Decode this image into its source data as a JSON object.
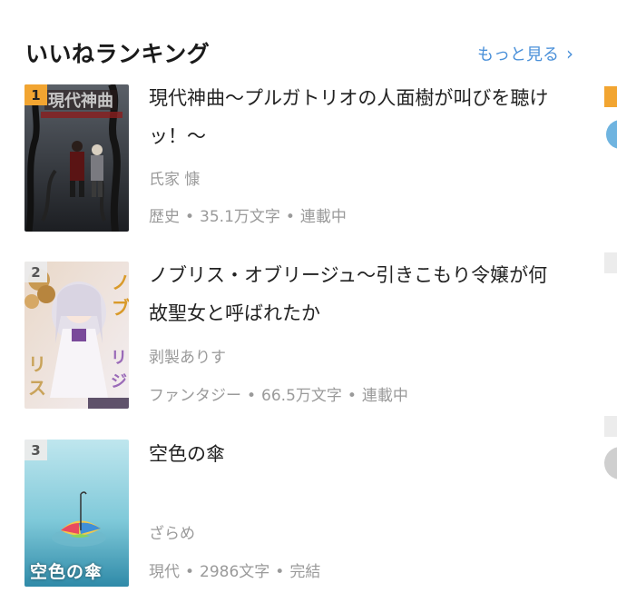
{
  "section": {
    "title": "いいねランキング",
    "more_label": "もっと見る"
  },
  "items": [
    {
      "rank": "1",
      "title": "現代神曲〜プルガトリオの人面樹が叫びを聴けッ！〜",
      "author": "氏家 慷",
      "genre": "歴史",
      "length": "35.1万文字",
      "status": "連載中"
    },
    {
      "rank": "2",
      "title": "ノブリス・オブリージュ〜引きこもり令嬢が何故聖女と呼ばれたか",
      "author": "剥製ありす",
      "genre": "ファンタジー",
      "length": "66.5万文字",
      "status": "連載中"
    },
    {
      "rank": "3",
      "title": "空色の傘",
      "author": "ざらめ",
      "genre": "現代",
      "length": "2986文字",
      "status": "完結",
      "cover_text": "空色の傘"
    }
  ],
  "colors": {
    "accent_link": "#4a90d9",
    "rank1_badge": "#f2a531",
    "muted_text": "#9a9a9a"
  },
  "icons": {
    "more_chevron": "chevron-right-icon"
  }
}
